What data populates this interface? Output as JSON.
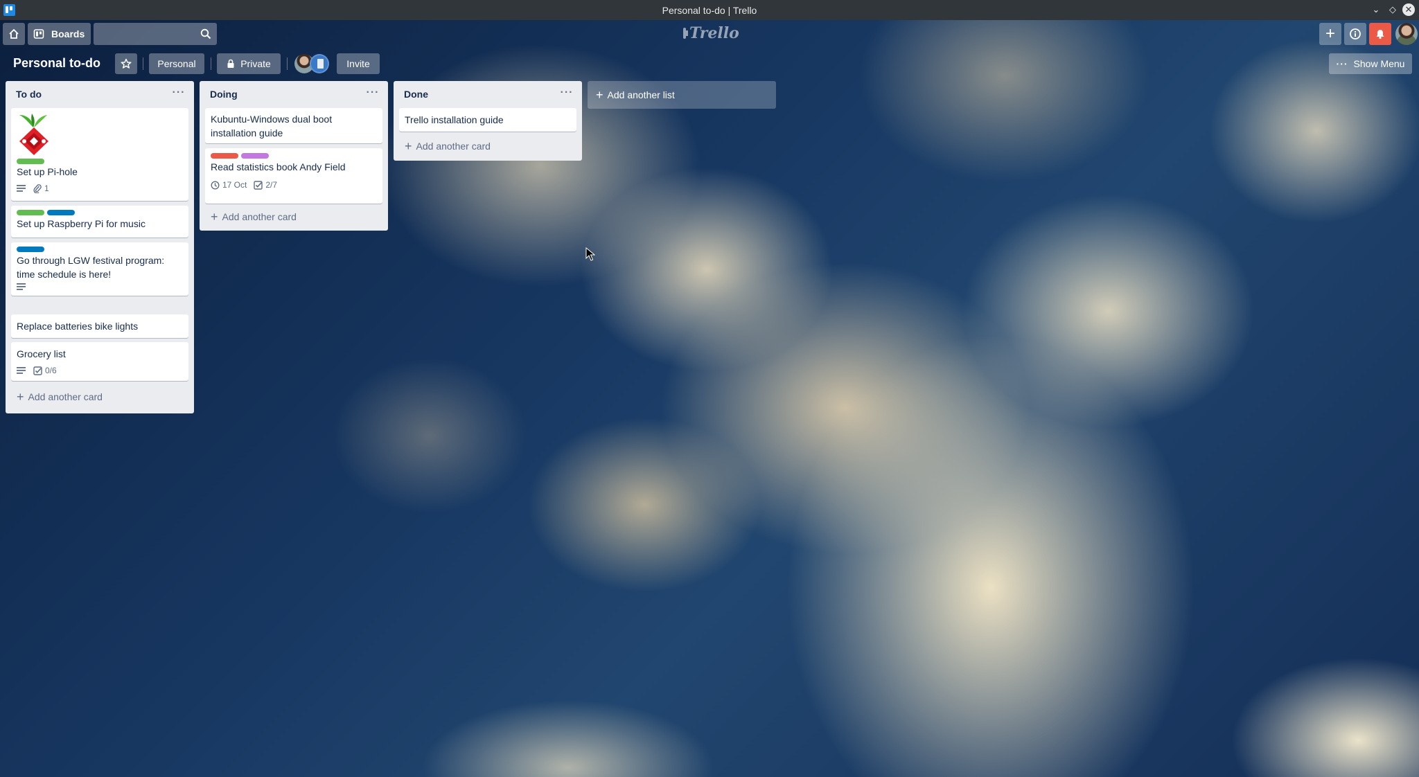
{
  "window": {
    "title": "Personal to-do | Trello"
  },
  "header": {
    "boards_label": "Boards",
    "search_value": "",
    "logo_text": "Trello"
  },
  "board": {
    "title": "Personal to-do",
    "team_label": "Personal",
    "visibility_label": "Private",
    "invite_label": "Invite",
    "menu_label": "Show Menu"
  },
  "colors": {
    "label_green": "#61bd4f",
    "label_blue": "#0079bf",
    "label_red": "#eb5a46",
    "label_purple": "#c377e0",
    "notification": "#eb5a46"
  },
  "lists": [
    {
      "title": "To do",
      "cards": [
        {
          "title": "Set up Pi-hole",
          "cover": "pi-hole-logo",
          "labels": [
            "green"
          ],
          "attachments": "1",
          "has_description": true
        },
        {
          "title": "Set up Raspberry Pi for music",
          "labels": [
            "green",
            "blue"
          ]
        },
        {
          "title": "Go through LGW festival program: time schedule is here!",
          "labels": [
            "blue"
          ],
          "has_description": true
        },
        {
          "title": "Replace batteries bike lights"
        },
        {
          "title": "Grocery list",
          "has_description": true,
          "checklist": "0/6"
        }
      ],
      "add_card_label": "Add another card"
    },
    {
      "title": "Doing",
      "cards": [
        {
          "title": "Kubuntu-Windows dual boot installation guide"
        },
        {
          "title": "Read statistics book Andy Field",
          "labels": [
            "red",
            "purple"
          ],
          "due": "17 Oct",
          "checklist": "2/7"
        }
      ],
      "add_card_label": "Add another card"
    },
    {
      "title": "Done",
      "cards": [
        {
          "title": "Trello installation guide"
        }
      ],
      "add_card_label": "Add another card"
    }
  ],
  "add_list_label": "Add another list"
}
